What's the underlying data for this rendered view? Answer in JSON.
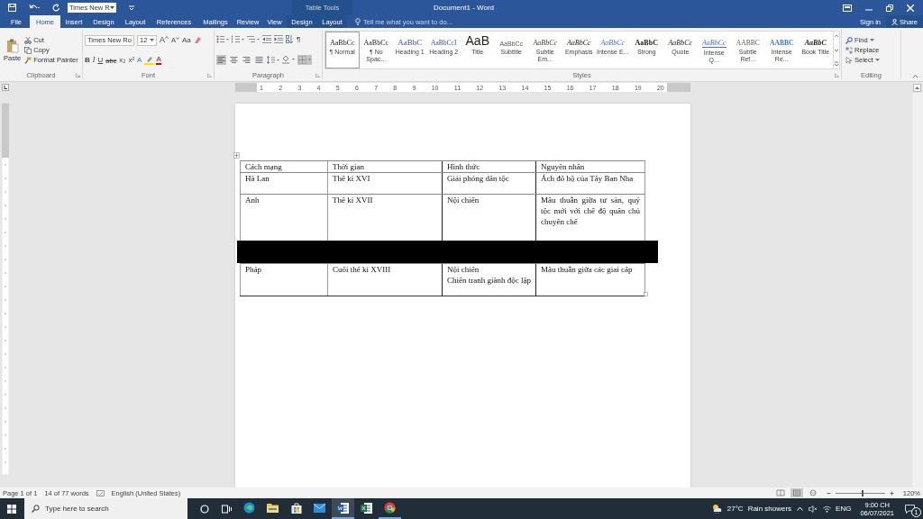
{
  "title_bar": {
    "font_box": "Times New R",
    "contextual_group": "Table Tools",
    "title": "Document1 - Word"
  },
  "ribbon_tabs": [
    {
      "label": "File",
      "selected": false,
      "kind": "standard"
    },
    {
      "label": "Home",
      "selected": true,
      "kind": "standard"
    },
    {
      "label": "Insert",
      "selected": false,
      "kind": "standard"
    },
    {
      "label": "Design",
      "selected": false,
      "kind": "standard"
    },
    {
      "label": "Layout",
      "selected": false,
      "kind": "standard"
    },
    {
      "label": "References",
      "selected": false,
      "kind": "standard"
    },
    {
      "label": "Mailings",
      "selected": false,
      "kind": "standard"
    },
    {
      "label": "Review",
      "selected": false,
      "kind": "standard"
    },
    {
      "label": "View",
      "selected": false,
      "kind": "standard"
    },
    {
      "label": "Design",
      "selected": false,
      "kind": "contextual"
    },
    {
      "label": "Layout",
      "selected": false,
      "kind": "contextual"
    }
  ],
  "tell_me": {
    "placeholder": "Tell me what you want to do..."
  },
  "account": {
    "sign_in": "Sign in",
    "share": "Share"
  },
  "clipboard": {
    "paste": "Paste",
    "cut": "Cut",
    "copy": "Copy",
    "format_painter": "Format Painter",
    "label": "Clipboard"
  },
  "font": {
    "name": "Times New Ro",
    "size": "12",
    "grow": "A",
    "shrink": "A",
    "change_case": "Aa",
    "format_buttons": [
      "B",
      "I",
      "U",
      "abc",
      "x₂",
      "x²"
    ],
    "effects": "A",
    "font_color": "A",
    "label": "Font"
  },
  "paragraph": {
    "pilcrow": "¶",
    "alignments": [
      {
        "selected": true
      },
      {
        "selected": false
      },
      {
        "selected": false
      },
      {
        "selected": false
      }
    ],
    "borders_selected": true,
    "label": "Paragraph"
  },
  "styles": {
    "label": "Styles",
    "items": [
      {
        "preview": "AaBbCc",
        "name": "¶ Normal",
        "selected": true
      },
      {
        "preview": "AaBbCc",
        "name": "¶ No Spac...",
        "selected": false
      },
      {
        "preview": "AaBbC",
        "name": "Heading 1",
        "selected": false
      },
      {
        "preview": "AaBbCcI",
        "name": "Heading 2",
        "selected": false
      },
      {
        "preview": "AaB",
        "name": "Title",
        "selected": false
      },
      {
        "preview": "AaBbCc",
        "name": "Subtitle",
        "selected": false
      },
      {
        "preview": "AaBbCc",
        "name": "Subtle Em...",
        "selected": false
      },
      {
        "preview": "AaBbCc",
        "name": "Emphasis",
        "selected": false
      },
      {
        "preview": "AaBbCc",
        "name": "Intense E...",
        "selected": false
      },
      {
        "preview": "AaBbC",
        "name": "Strong",
        "selected": false
      },
      {
        "preview": "AaBbCc",
        "name": "Quote",
        "selected": false
      },
      {
        "preview": "AaBbCc",
        "name": "Intense Q...",
        "selected": false
      },
      {
        "preview": "AABBC",
        "name": "Subtle Ref...",
        "selected": false
      },
      {
        "preview": "AABBC",
        "name": "Intense Re...",
        "selected": false
      },
      {
        "preview": "AaBbC",
        "name": "Book Title",
        "selected": false
      }
    ]
  },
  "editing": {
    "find": "Find",
    "replace": "Replace",
    "select": "Select",
    "label": "Editing"
  },
  "ruler": {
    "numbers": [
      "1",
      "2",
      "3",
      "4",
      "5",
      "6",
      "7",
      "8",
      "9",
      "10",
      "11",
      "12",
      "13",
      "14",
      "15",
      "16",
      "17",
      "18",
      "19",
      "20"
    ]
  },
  "table": {
    "columns": [
      "Cách mạng",
      "Thời gian",
      "Hình thức",
      "Nguyên nhân"
    ],
    "rows": [
      {
        "kind": "text",
        "cells": [
          [
            "Hà Lan"
          ],
          [
            "Thế kỉ XVI"
          ],
          [
            "Giải phóng dân tộc"
          ],
          [
            "Ách đô hộ của Tây Ban Nha"
          ]
        ]
      },
      {
        "kind": "text",
        "cells": [
          [
            "Anh"
          ],
          [
            "Thế kỉ XVII"
          ],
          [
            "Nội chiến"
          ],
          [
            "Mâu thuẫn giữa tư sản, quý tộc mới với chế độ quân chủ chuyên chế"
          ]
        ]
      },
      {
        "kind": "redacted"
      },
      {
        "kind": "text",
        "cells": [
          [
            "Pháp"
          ],
          [
            "Cuối thế kỉ XVIII"
          ],
          [
            "Nội chiến",
            "Chiến tranh giành độc lập"
          ],
          [
            "Mâu thuẫn giữa các giai cấp"
          ]
        ]
      }
    ]
  },
  "status_bar": {
    "page": "Page 1 of 1",
    "words": "14 of 77 words",
    "language": "English (United States)",
    "views": [
      {
        "selected": false
      },
      {
        "selected": true
      },
      {
        "selected": false
      }
    ],
    "zoom": {
      "level": 0.55,
      "reading": "120%"
    }
  },
  "taskbar": {
    "search": {
      "placeholder": "Type here to search"
    },
    "apps": [
      {
        "kind": "edge",
        "running": false,
        "selected": false
      },
      {
        "kind": "explorer",
        "running": false,
        "selected": false
      },
      {
        "kind": "store",
        "running": false,
        "selected": false
      },
      {
        "kind": "mail",
        "running": false,
        "selected": false
      },
      {
        "kind": "word",
        "running": true,
        "selected": true
      },
      {
        "kind": "excel",
        "running": false,
        "selected": false
      },
      {
        "kind": "chrome",
        "running": true,
        "selected": false
      }
    ],
    "temperature": "27°C",
    "condition": "Rain showers",
    "language": "ENG",
    "time": "9:00 CH",
    "date": "06/07/2021",
    "notifications": "1"
  }
}
